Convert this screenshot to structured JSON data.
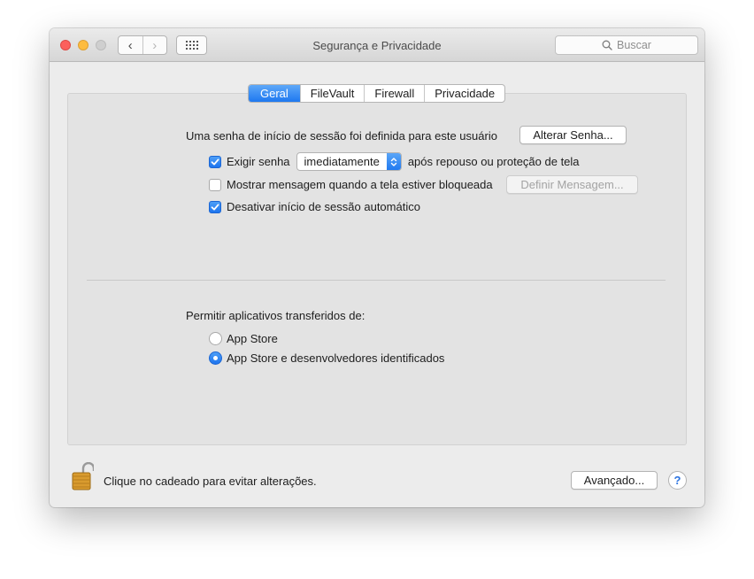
{
  "window": {
    "title": "Segurança e Privacidade",
    "search_placeholder": "Buscar"
  },
  "nav": {
    "back_glyph": "‹",
    "forward_glyph": "›"
  },
  "tabs": [
    {
      "label": "Geral",
      "active": true
    },
    {
      "label": "FileVault",
      "active": false
    },
    {
      "label": "Firewall",
      "active": false
    },
    {
      "label": "Privacidade",
      "active": false
    }
  ],
  "general": {
    "password_set_text": "Uma senha de início de sessão foi definida para este usuário",
    "change_password_button": "Alterar Senha...",
    "require_password": {
      "checked": true,
      "label_before": "Exigir senha",
      "popup_value": "imediatamente",
      "label_after": "após repouso ou proteção de tela"
    },
    "show_message": {
      "checked": false,
      "label": "Mostrar mensagem quando a tela estiver bloqueada",
      "button": "Definir Mensagem..."
    },
    "disable_auto_login": {
      "checked": true,
      "label": "Desativar início de sessão automático"
    }
  },
  "apps": {
    "heading": "Permitir aplicativos transferidos de:",
    "options": [
      {
        "label": "App Store",
        "selected": false
      },
      {
        "label": "App Store e desenvolvedores identificados",
        "selected": true
      }
    ]
  },
  "footer": {
    "lock_text": "Clique no cadeado para evitar alterações.",
    "advanced_button": "Avançado...",
    "help_glyph": "?"
  },
  "colors": {
    "accent": "#1e78f0",
    "window_bg": "#ececec",
    "panel_bg": "#e3e3e3"
  },
  "icons": [
    "search-icon",
    "grid-icon",
    "chevron-left-icon",
    "chevron-right-icon",
    "checkmark-icon",
    "popup-arrows-icon",
    "padlock-icon",
    "help-icon"
  ]
}
